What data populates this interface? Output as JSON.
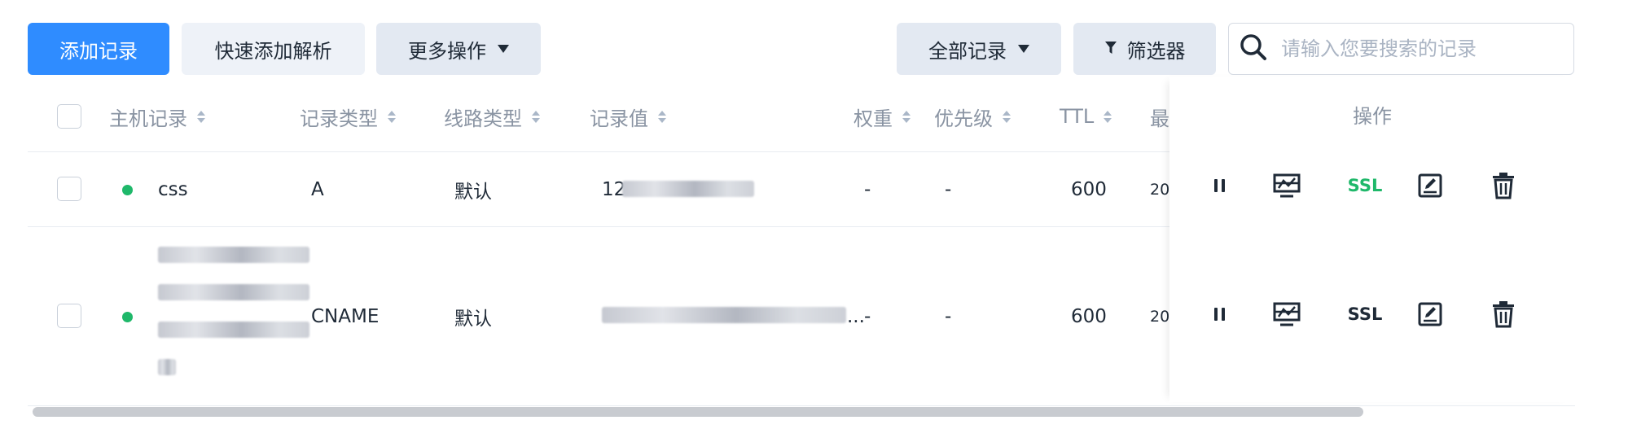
{
  "toolbar": {
    "add_record": "添加记录",
    "quick_add": "快速添加解析",
    "more_ops": "更多操作",
    "all_records": "全部记录",
    "filter": "筛选器",
    "search_placeholder": "请输入您要搜索的记录",
    "search_value": ""
  },
  "table": {
    "columns": {
      "host": "主机记录",
      "type": "记录类型",
      "line": "线路类型",
      "value": "记录值",
      "weight": "权重",
      "priority": "优先级",
      "ttl": "TTL",
      "last": "最",
      "actions": "操作"
    },
    "rows": [
      {
        "host": "css",
        "type": "A",
        "line": "默认",
        "value_visible": "12",
        "weight": "-",
        "priority": "-",
        "ttl": "600",
        "last": "20",
        "status": "enabled",
        "ssl_label": "SSL",
        "ssl_color": "#1fb86a"
      },
      {
        "host": "",
        "type": "CNAME",
        "line": "默认",
        "value_visible": "...",
        "weight": "-",
        "priority": "-",
        "ttl": "600",
        "last": "20",
        "status": "enabled",
        "ssl_label": "SSL",
        "ssl_color": "#1f2a37"
      }
    ]
  },
  "colors": {
    "primary": "#2f8cff",
    "status_green": "#1fb86a",
    "header_text": "#8a94a3"
  },
  "icons": [
    "search-icon",
    "filter-icon",
    "caret-down-icon",
    "pause-icon",
    "monitor-icon",
    "edit-icon",
    "trash-icon"
  ]
}
